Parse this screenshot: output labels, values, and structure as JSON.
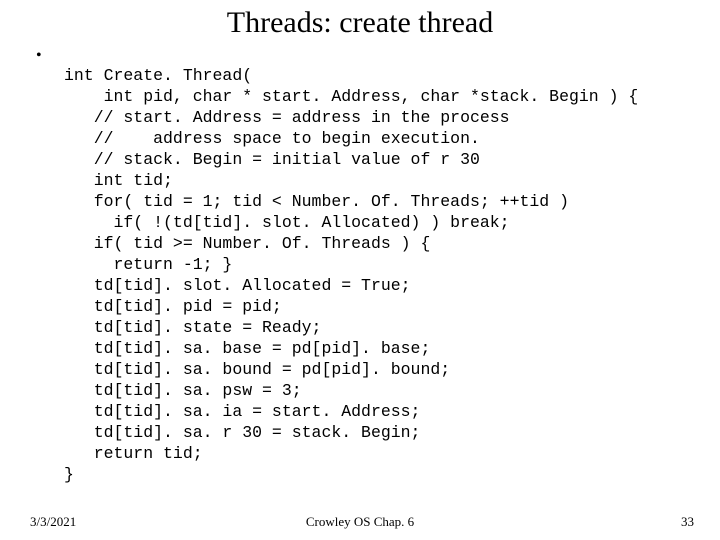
{
  "title": "Threads: create thread",
  "bullet_glyph": "•",
  "code_lines": [
    "int Create. Thread(",
    "    int pid, char * start. Address, char *stack. Begin ) {",
    "   // start. Address = address in the process",
    "   //    address space to begin execution.",
    "   // stack. Begin = initial value of r 30",
    "   int tid;",
    "   for( tid = 1; tid < Number. Of. Threads; ++tid )",
    "     if( !(td[tid]. slot. Allocated) ) break;",
    "   if( tid >= Number. Of. Threads ) {",
    "     return -1; }",
    "   td[tid]. slot. Allocated = True;",
    "   td[tid]. pid = pid;",
    "   td[tid]. state = Ready;",
    "   td[tid]. sa. base = pd[pid]. base;",
    "   td[tid]. sa. bound = pd[pid]. bound;",
    "   td[tid]. sa. psw = 3;",
    "   td[tid]. sa. ia = start. Address;",
    "   td[tid]. sa. r 30 = stack. Begin;",
    "   return tid;",
    "}"
  ],
  "footer": {
    "date": "3/3/2021",
    "center": "Crowley    OS     Chap. 6",
    "pagenum": "33"
  }
}
